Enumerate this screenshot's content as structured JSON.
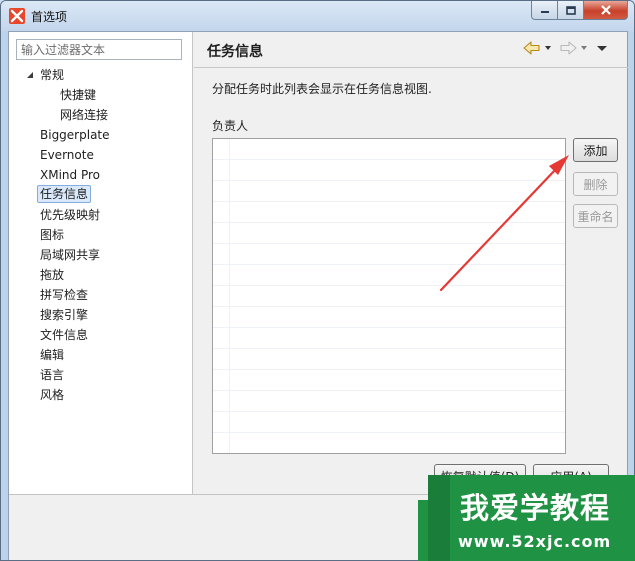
{
  "window": {
    "title": "首选项",
    "brand_color": "#c8412a"
  },
  "filter": {
    "placeholder": "输入过滤器文本"
  },
  "tree": {
    "items": [
      {
        "label": "常规",
        "level": 0,
        "expanded": true
      },
      {
        "label": "快捷键",
        "level": 1
      },
      {
        "label": "网络连接",
        "level": 1
      },
      {
        "label": "Biggerplate",
        "level": 0
      },
      {
        "label": "Evernote",
        "level": 0
      },
      {
        "label": "XMind Pro",
        "level": 0
      },
      {
        "label": "任务信息",
        "level": 0,
        "selected": true
      },
      {
        "label": "优先级映射",
        "level": 0
      },
      {
        "label": "图标",
        "level": 0
      },
      {
        "label": "局域网共享",
        "level": 0
      },
      {
        "label": "拖放",
        "level": 0
      },
      {
        "label": "拼写检查",
        "level": 0
      },
      {
        "label": "搜索引擎",
        "level": 0
      },
      {
        "label": "文件信息",
        "level": 0
      },
      {
        "label": "编辑",
        "level": 0
      },
      {
        "label": "语言",
        "level": 0
      },
      {
        "label": "风格",
        "level": 0
      }
    ]
  },
  "page": {
    "title": "任务信息",
    "description": "分配任务时此列表会显示在任务信息视图.",
    "owner_label": "负责人"
  },
  "buttons": {
    "add": "添加",
    "delete": "删除",
    "rename": "重命名",
    "restore_defaults": "恢复默认值(D)",
    "apply": "应用(A)"
  },
  "icons": {
    "back": "back-arrow-icon",
    "forward": "forward-arrow-icon",
    "menu": "dropdown-icon"
  },
  "watermark": {
    "main": "我爱学教程",
    "url": "www.52xjc.com",
    "color": "#1f9244"
  },
  "annotation": {
    "color": "#e53935"
  }
}
